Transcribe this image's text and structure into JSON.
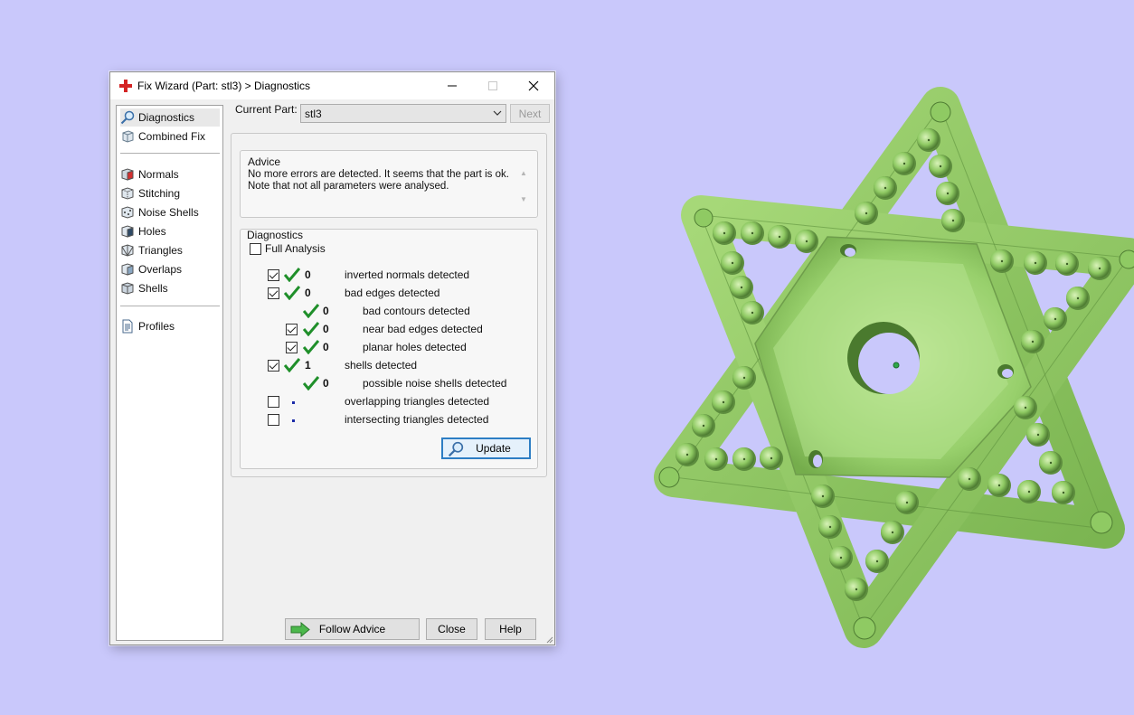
{
  "window": {
    "title": "Fix Wizard (Part: stl3) > Diagnostics"
  },
  "nav": {
    "items": [
      {
        "label": "Diagnostics",
        "icon": "magnifier-icon"
      },
      {
        "label": "Combined Fix",
        "icon": "cube-icon"
      },
      {
        "label": "Normals",
        "icon": "normals-cube-icon"
      },
      {
        "label": "Stitching",
        "icon": "stitching-cube-icon"
      },
      {
        "label": "Noise Shells",
        "icon": "noise-shells-icon"
      },
      {
        "label": "Holes",
        "icon": "holes-cube-icon"
      },
      {
        "label": "Triangles",
        "icon": "triangles-cube-icon"
      },
      {
        "label": "Overlaps",
        "icon": "overlaps-cube-icon"
      },
      {
        "label": "Shells",
        "icon": "shells-cube-icon"
      },
      {
        "label": "Profiles",
        "icon": "document-icon"
      }
    ]
  },
  "current_part": {
    "label": "Current Part:",
    "value": "stl3",
    "next_label": "Next"
  },
  "advice": {
    "title": "Advice",
    "line1": "No more errors are detected. It seems that the part is ok.",
    "line2": "Note that not all parameters were analysed."
  },
  "diagnostics": {
    "title": "Diagnostics",
    "full_analysis_label": "Full Analysis",
    "rows": [
      {
        "count": "0",
        "text": "inverted normals detected"
      },
      {
        "count": "0",
        "text": "bad edges detected"
      },
      {
        "count": "0",
        "text": "bad contours detected"
      },
      {
        "count": "0",
        "text": "near bad edges detected"
      },
      {
        "count": "0",
        "text": "planar holes detected"
      },
      {
        "count": "1",
        "text": "shells detected"
      },
      {
        "count": "0",
        "text": "possible noise shells detected"
      },
      {
        "count": "",
        "text": "overlapping triangles detected"
      },
      {
        "count": "",
        "text": "intersecting triangles detected"
      }
    ],
    "update_label": "Update"
  },
  "footer": {
    "follow_advice_label": "Follow Advice",
    "close_label": "Close",
    "help_label": "Help"
  },
  "colors": {
    "background": "#c9c8fb",
    "model_green": "#8fca63",
    "check_green": "#1f8f2a"
  }
}
